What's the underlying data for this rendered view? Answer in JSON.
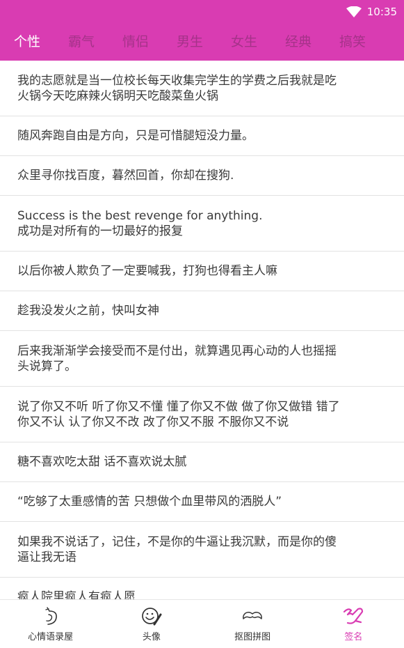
{
  "status": {
    "time": "10:35",
    "wifi_icon": "wifi-icon"
  },
  "tabs": [
    {
      "label": "个性",
      "active": true
    },
    {
      "label": "霸气",
      "active": false
    },
    {
      "label": "情侣",
      "active": false
    },
    {
      "label": "男生",
      "active": false
    },
    {
      "label": "女生",
      "active": false
    },
    {
      "label": "经典",
      "active": false
    },
    {
      "label": "搞笑",
      "active": false
    }
  ],
  "quotes": [
    {
      "text": "我的志愿就是当一位校长每天收集完学生的学费之后我就是吃\n火锅今天吃麻辣火锅明天吃酸菜鱼火锅"
    },
    {
      "text": "随风奔跑自由是方向，只是可惜腿短没力量。"
    },
    {
      "text": "众里寻你找百度，暮然回首，你却在搜狗."
    },
    {
      "text": "Success is the best revenge for anything.\n成功是对所有的一切最好的报复"
    },
    {
      "text": "以后你被人欺负了一定要喊我，打狗也得看主人嘛"
    },
    {
      "text": "趁我没发火之前，快叫女神"
    },
    {
      "text": "后来我渐渐学会接受而不是付出，就算遇见再心动的人也摇摇\n头说算了。"
    },
    {
      "text": "说了你又不听 听了你又不懂 懂了你又不做 做了你又做错 错了\n你又不认 认了你又不改 改了你又不服 不服你又不说"
    },
    {
      "text": "糖不喜欢吃太甜 话不喜欢说太腻"
    },
    {
      "text": "“吃够了太重感情的苦 只想做个血里带风的洒脱人”"
    },
    {
      "text": "如果我不说话了，记住，不是你的牛逼让我沉默，而是你的傻\n逼让我无语"
    },
    {
      "text": "疯人院里疯人有疯人愿"
    }
  ],
  "bottom_nav": [
    {
      "label": "心情语录屋",
      "icon": "mood-quote-icon",
      "active": false
    },
    {
      "label": "头像",
      "icon": "avatar-face-icon",
      "active": false
    },
    {
      "label": "抠图拼图",
      "icon": "mustache-icon",
      "active": false
    },
    {
      "label": "签名",
      "icon": "signature-icon",
      "active": true
    }
  ],
  "colors": {
    "accent": "#d93cb2",
    "inactive_tab": "#a53289",
    "text": "#3a3a3a"
  }
}
